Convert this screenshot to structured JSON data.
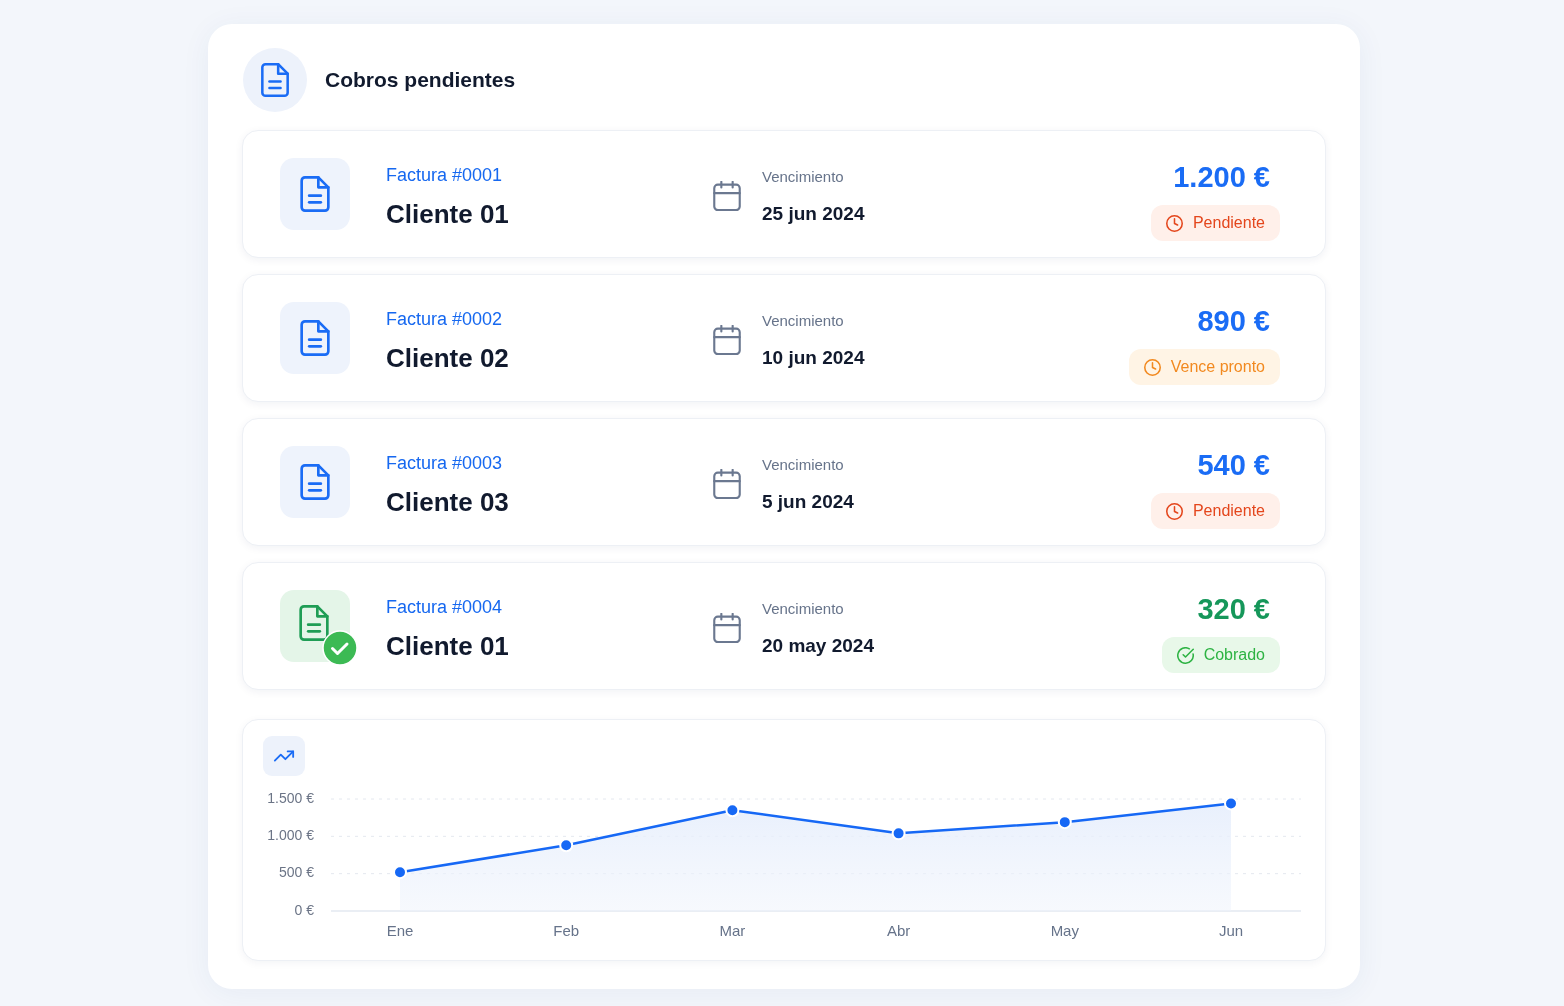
{
  "header": {
    "title": "Cobros pendientes"
  },
  "invoices": [
    {
      "number": "Factura #0001",
      "client": "Cliente 01",
      "due_label": "Vencimiento",
      "due_date": "25 jun 2024",
      "amount": "1.200 €",
      "kind": "pending",
      "status": "Pendiente"
    },
    {
      "number": "Factura #0002",
      "client": "Cliente 02",
      "due_label": "Vencimiento",
      "due_date": "10 jun 2024",
      "amount": "890 €",
      "kind": "due_soon",
      "status": "Vence pronto"
    },
    {
      "number": "Factura #0003",
      "client": "Cliente 03",
      "due_label": "Vencimiento",
      "due_date": "5 jun 2024",
      "amount": "540 €",
      "kind": "pending",
      "status": "Pendiente"
    },
    {
      "number": "Factura #0004",
      "client": "Cliente 01",
      "due_label": "Vencimiento",
      "due_date": "20 may 2024",
      "amount": "320 €",
      "kind": "paid",
      "status": "Cobrado"
    }
  ],
  "chart": {
    "chart_data": {
      "type": "area",
      "categories": [
        "Ene",
        "Feb",
        "Mar",
        "Abr",
        "May",
        "Jun"
      ],
      "series": [
        {
          "color": "#1668f5",
          "values": [
            520,
            880,
            1350,
            1040,
            1190,
            1440
          ]
        }
      ],
      "ylim": [
        0,
        1500
      ],
      "yticks": [
        {
          "value": 0,
          "label": "0 €"
        },
        {
          "value": 500,
          "label": "500 €"
        },
        {
          "value": 1000,
          "label": "1.000 €"
        },
        {
          "value": 1500,
          "label": "1.500 €"
        }
      ]
    }
  }
}
